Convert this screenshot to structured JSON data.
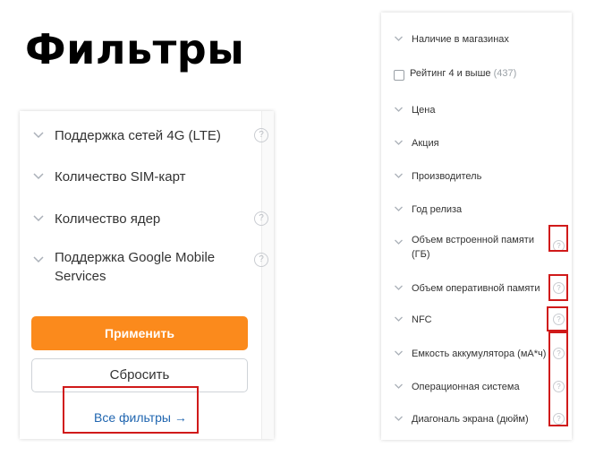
{
  "page_title": "Фильтры",
  "left_panel": {
    "items": [
      {
        "label": "Поддержка сетей 4G (LTE)",
        "help": true
      },
      {
        "label": "Количество SIM-карт",
        "help": false
      },
      {
        "label": "Количество ядер",
        "help": true
      },
      {
        "label": "Поддержка Google Mobile Services",
        "help": true
      }
    ],
    "apply_label": "Применить",
    "reset_label": "Сбросить",
    "all_filters_label": "Все фильтры →"
  },
  "right_panel": {
    "in_stores_label": "Наличие в магазинах",
    "rating_label": "Рейтинг 4 и выше",
    "rating_count": "(437)",
    "items": [
      {
        "label": "Цена"
      },
      {
        "label": "Акция"
      },
      {
        "label": "Производитель"
      },
      {
        "label": "Год релиза"
      },
      {
        "label": "Объем встроенной памяти (ГБ)"
      },
      {
        "label": "Объем оперативной памяти"
      },
      {
        "label": "NFC"
      },
      {
        "label": "Емкость аккумулятора (мА*ч)"
      },
      {
        "label": "Операционная система"
      },
      {
        "label": "Диагональ экрана (дюйм)"
      }
    ]
  },
  "icons": {
    "chevron": "chevron-down-icon",
    "help": "question-circle-icon"
  },
  "colors": {
    "apply_bg": "#fb8a1c",
    "link": "#2066b0",
    "highlight": "#d01a1a"
  }
}
